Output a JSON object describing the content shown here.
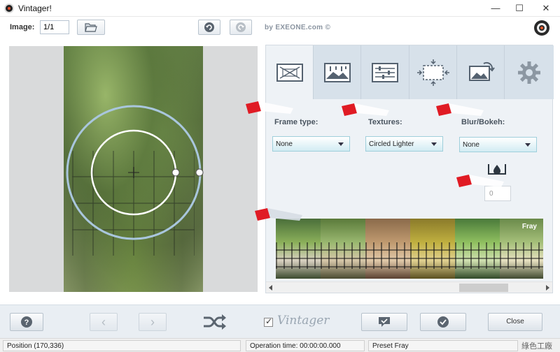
{
  "window": {
    "title": "Vintager!",
    "minimize_glyph": "—",
    "maximize_glyph": "☐",
    "close_glyph": "✕"
  },
  "toolbar": {
    "image_label": "Image:",
    "image_value": "1/1",
    "open_icon": "folder-open-icon",
    "undo_icon": "undo-icon",
    "redo_icon": "redo-icon",
    "byline": "by EXEONE.com ©"
  },
  "panel": {
    "tabs": [
      {
        "id": "frames",
        "icon": "frame-icon"
      },
      {
        "id": "textures",
        "icon": "texture-icon"
      },
      {
        "id": "adjust",
        "icon": "sliders-icon"
      },
      {
        "id": "crop",
        "icon": "crop-resize-icon"
      },
      {
        "id": "rotate",
        "icon": "rotate-image-icon"
      },
      {
        "id": "settings",
        "icon": "gear-icon"
      }
    ],
    "frame_type": {
      "label": "Frame type:",
      "value": "None"
    },
    "textures": {
      "label": "Textures:",
      "value": "Circled Lighter"
    },
    "blur": {
      "label": "Blur/Bokeh:",
      "value": "None"
    },
    "bokeh_amount": "0",
    "preset_label": "Fray"
  },
  "bottom": {
    "help_glyph": "?",
    "prev_glyph": "‹",
    "next_glyph": "›",
    "vintager_logo": "Vintager",
    "close_label": "Close"
  },
  "status": {
    "position": "Position (170,336)",
    "operation_time": "Operation time: 00:00:00.000",
    "preset": "Preset Fray",
    "watermark": "綠色工廠"
  },
  "colors": {
    "accent": "#9fcfdb",
    "flag_red": "#e01b24",
    "panel_bg": "#eef2f6"
  }
}
